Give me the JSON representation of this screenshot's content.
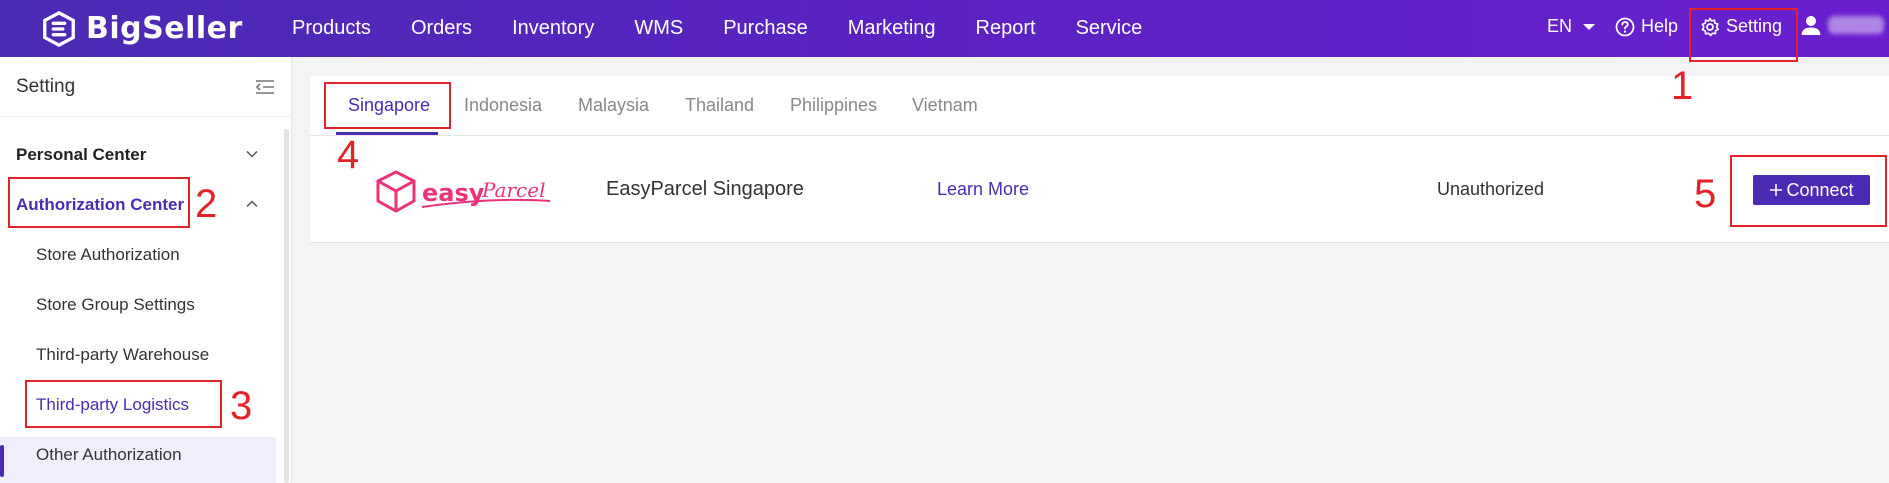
{
  "header": {
    "brand": "BigSeller",
    "nav": [
      "Products",
      "Orders",
      "Inventory",
      "WMS",
      "Purchase",
      "Marketing",
      "Report",
      "Service"
    ],
    "language": "EN",
    "help": "Help",
    "setting": "Setting"
  },
  "sidebar": {
    "title": "Setting",
    "groups": [
      {
        "label": "Personal Center"
      },
      {
        "label": "Authorization Center"
      }
    ],
    "items": [
      {
        "label": "Store Authorization"
      },
      {
        "label": "Store Group Settings"
      },
      {
        "label": "Third-party Warehouse"
      },
      {
        "label": "Third-party Logistics"
      },
      {
        "label": "Other Authorization"
      }
    ]
  },
  "main": {
    "tabs": [
      "Singapore",
      "Indonesia",
      "Malaysia",
      "Thailand",
      "Philippines",
      "Vietnam"
    ],
    "active_tab": "Singapore",
    "carrier": {
      "name": "EasyParcel Singapore",
      "learn_more": "Learn More",
      "status": "Unauthorized",
      "connect": "Connect"
    }
  },
  "annotations": [
    "1",
    "2",
    "3",
    "4",
    "5"
  ],
  "colors": {
    "accent": "#4b2bb3",
    "annotation": "#e3222a",
    "carrier_brand": "#e7347a"
  }
}
